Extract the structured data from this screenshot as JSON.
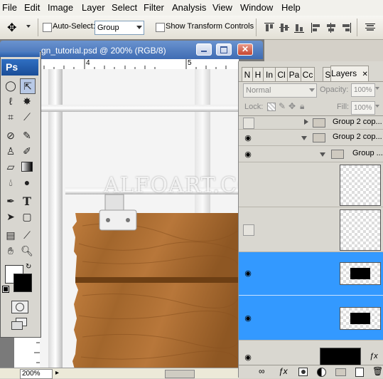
{
  "menu": [
    "File",
    "Edit",
    "Image",
    "Layer",
    "Select",
    "Filter",
    "Analysis",
    "View",
    "Window",
    "Help"
  ],
  "options": {
    "auto_select_label": "Auto-Select:",
    "auto_select_value": "Group",
    "show_transform_label": "Show Transform Controls"
  },
  "document": {
    "title": "gn_tutorial.psd @ 200% (RGB/8)",
    "ruler_marks": [
      "4",
      "5"
    ],
    "watermark": "ALFOART.COM",
    "zoom": "200%"
  },
  "tools_panel": {
    "logo": "Ps",
    "tools": [
      "marquee-icon",
      "move-icon",
      "lasso-icon",
      "magic-wand-icon",
      "crop-icon",
      "eyedropper-icon",
      "healing-icon",
      "brush-icon",
      "stamp-icon",
      "history-brush-icon",
      "eraser-icon",
      "gradient-icon",
      "blur-icon",
      "dodge-icon",
      "pen-icon",
      "type-icon",
      "path-select-icon",
      "shape-icon",
      "notes-icon",
      "eyedropper2-icon",
      "hand-icon",
      "zoom-icon"
    ],
    "quick_mask": "quick-mask-icon",
    "screen_mode": "screen-mode-icon"
  },
  "layers_panel": {
    "tabs": [
      "N",
      "H",
      "In",
      "Cl",
      "Pa",
      "Cc",
      "St",
      "Layers"
    ],
    "blend_mode": "Normal",
    "opacity_label": "Opacity:",
    "opacity_value": "100%",
    "lock_label": "Lock:",
    "fill_label": "Fill:",
    "fill_value": "100%",
    "groups": [
      "Group 2 cop...",
      "Group 2 cop...",
      "Group ..."
    ],
    "footer_icons": [
      "link-icon",
      "fx-icon",
      "mask-icon",
      "adjustment-icon",
      "new-group-icon",
      "new-layer-icon",
      "trash-icon"
    ]
  },
  "colors": {
    "selection": "#3399ff",
    "title_bar": "#3f6cb3",
    "wood": "#a86a2e"
  }
}
